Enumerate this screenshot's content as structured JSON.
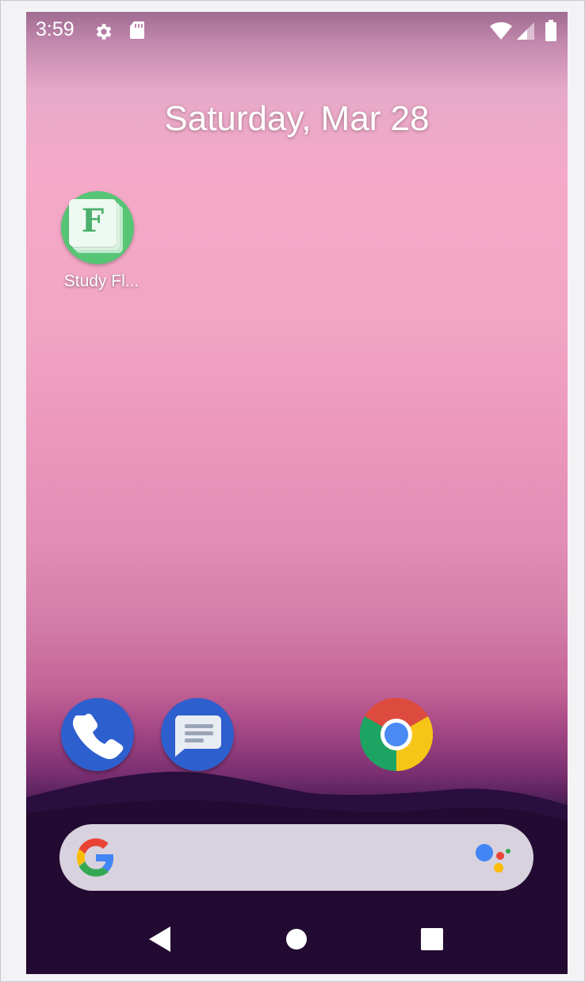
{
  "status_bar": {
    "time": "3:59",
    "icons": [
      "gear-icon",
      "sd-card-icon",
      "wifi-icon",
      "signal-icon",
      "battery-icon"
    ]
  },
  "home": {
    "date": "Saturday, Mar 28",
    "apps": [
      {
        "label": "Study Fl...",
        "icon": "study-flashcards-icon",
        "letter": "F"
      }
    ]
  },
  "dock": {
    "apps": [
      "phone-icon",
      "messages-icon",
      "chrome-icon"
    ]
  },
  "search": {
    "icons": [
      "google-g-icon",
      "google-assistant-icon"
    ]
  },
  "nav_bar": {
    "buttons": [
      "back-button",
      "home-button",
      "recents-button"
    ]
  },
  "colors": {
    "wallpaper_top": "#f3a9c7",
    "wallpaper_bottom": "#1c0a2c",
    "app_icon_bg": "#57c576",
    "dock_blue": "#3a6bd9",
    "search_bar": "#d7d2dd"
  }
}
